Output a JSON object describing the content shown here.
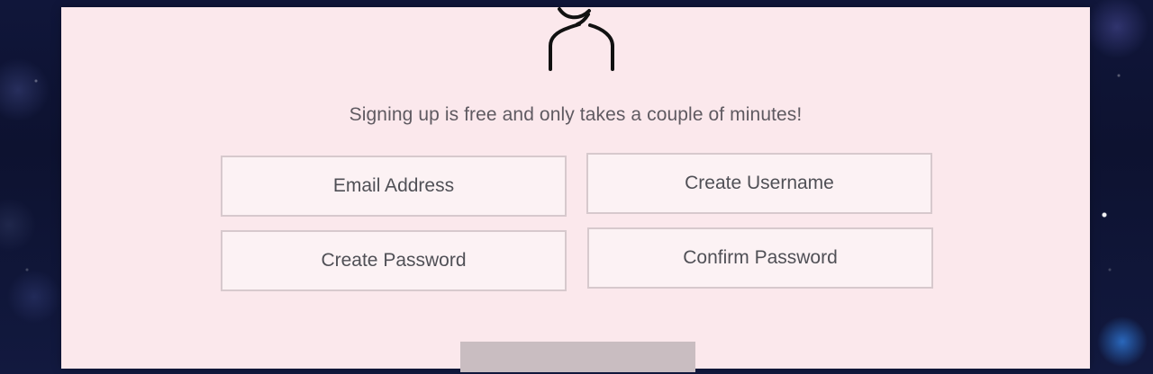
{
  "signup": {
    "tagline": "Signing up is free and only takes a couple of minutes!",
    "fields": {
      "email": {
        "placeholder": "Email Address"
      },
      "username": {
        "placeholder": "Create Username"
      },
      "password": {
        "placeholder": "Create Password"
      },
      "confirm_password": {
        "placeholder": "Confirm Password"
      }
    },
    "icon": "user-icon",
    "button_label": ""
  },
  "colors": {
    "panel": "#fbe8ec",
    "text": "#5f5a61",
    "field_border": "#d7c9cd",
    "button": "#c9bdc1",
    "space_background": "#10163a"
  }
}
